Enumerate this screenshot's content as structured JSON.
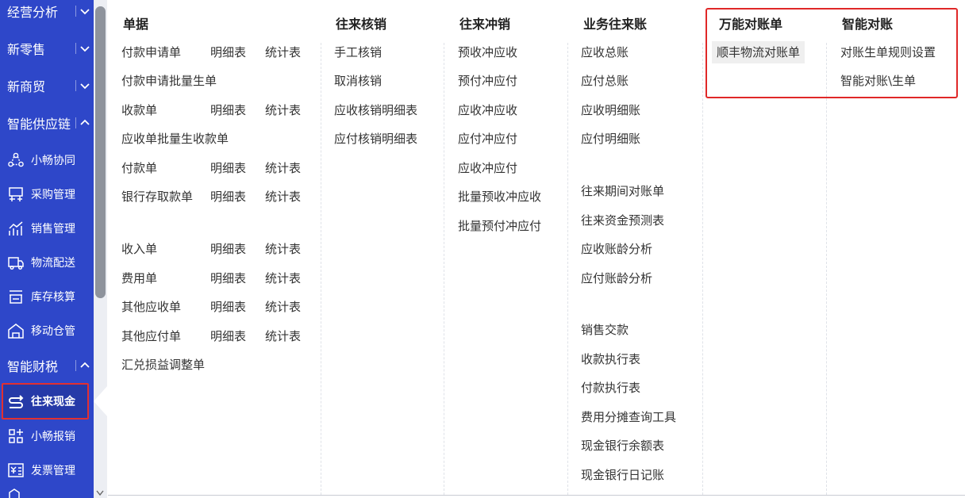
{
  "sidebar": {
    "sections": {
      "jingying": "经营分析",
      "xinlingshou": "新零售",
      "xinshangmao": "新商贸",
      "zhinenggongyinglian": "智能供应链",
      "zhinengcaishui": "智能财税"
    },
    "supply_items": {
      "xiaochang": "小畅协同",
      "caigou": "采购管理",
      "xiaoshou": "销售管理",
      "wuliu": "物流配送",
      "kucun": "库存核算",
      "yidong": "移动仓管"
    },
    "finance_items": {
      "wanglai": "往来现金",
      "baoxiao": "小畅报销",
      "fapiao": "发票管理"
    }
  },
  "menu": {
    "danju": {
      "title": "单据",
      "fukuanshenqing": "付款申请单",
      "fukuanshenqing_mx": "明细表",
      "fukuanshenqing_tj": "统计表",
      "fukuanshenqing_pl": "付款申请批量生单",
      "shoukuan": "收款单",
      "shoukuan_mx": "明细表",
      "shoukuan_tj": "统计表",
      "yingshou_pl": "应收单批量生收款单",
      "fukuan": "付款单",
      "fukuan_mx": "明细表",
      "fukuan_tj": "统计表",
      "yinhang": "银行存取款单",
      "yinhang_mx": "明细表",
      "yinhang_tj": "统计表",
      "shouru": "收入单",
      "shouru_mx": "明细表",
      "shouru_tj": "统计表",
      "feiyong": "费用单",
      "feiyong_mx": "明细表",
      "feiyong_tj": "统计表",
      "qitayingshou": "其他应收单",
      "qitayingshou_mx": "明细表",
      "qitayingshou_tj": "统计表",
      "qitayingfu": "其他应付单",
      "qitayingfu_mx": "明细表",
      "qitayingfu_tj": "统计表",
      "huidui": "汇兑损益调整单"
    },
    "hexiao": {
      "title": "往来核销",
      "shougong": "手工核销",
      "quxiao": "取消核销",
      "yingshou_mx": "应收核销明细表",
      "yingfu_mx": "应付核销明细表"
    },
    "chongxiao": {
      "title": "往来冲销",
      "yushou_ys": "预收冲应收",
      "yufu_yf": "预付冲应付",
      "ys_ys": "应收冲应收",
      "yf_yf": "应付冲应付",
      "ys_yf": "应收冲应付",
      "pl_yushou": "批量预收冲应收",
      "pl_yufu": "批量预付冲应付"
    },
    "yewu": {
      "title": "业务往来账",
      "yingshou_zong": "应收总账",
      "yingfu_zong": "应付总账",
      "yingshou_mx": "应收明细账",
      "yingfu_mx": "应付明细账",
      "qijian": "往来期间对账单",
      "zijin": "往来资金预测表",
      "ys_zhangling": "应收账龄分析",
      "yf_zhangling": "应付账龄分析",
      "jiaokuan": "销售交款",
      "shoukuan_zx": "收款执行表",
      "fukuan_zx": "付款执行表",
      "fentan": "费用分摊查询工具",
      "yue": "现金银行余额表",
      "rijizhang": "现金银行日记账"
    },
    "wanneng": {
      "title": "万能对账单",
      "shunfeng": "顺丰物流对账单"
    },
    "zhineng": {
      "title": "智能对账",
      "guize": "对账生单规则设置",
      "shengdan": "智能对账\\生单"
    }
  }
}
